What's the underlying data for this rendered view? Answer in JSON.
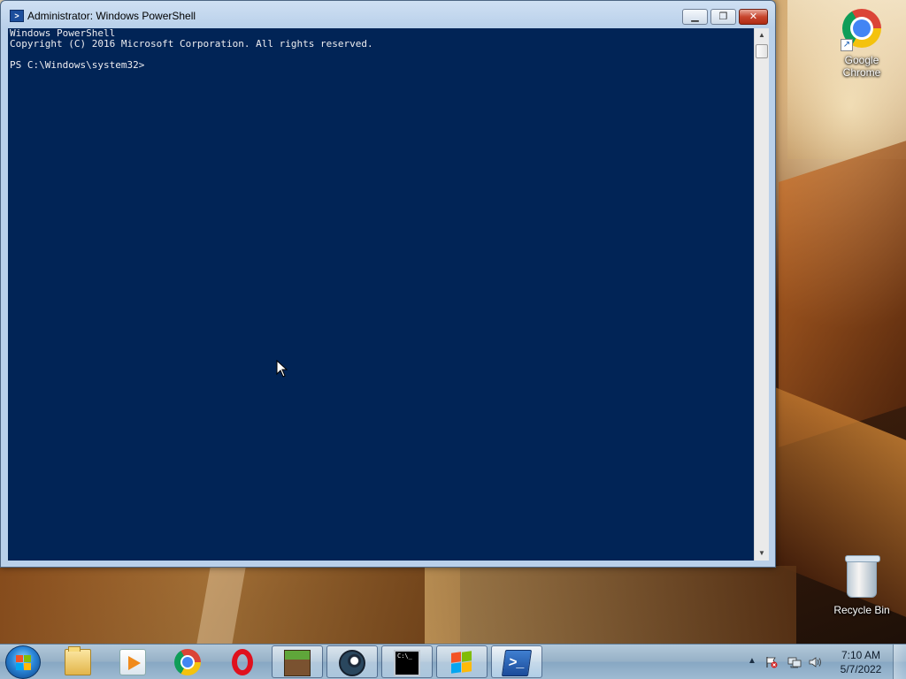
{
  "window": {
    "title": "Administrator: Windows PowerShell",
    "minimize_label": "▁",
    "maximize_label": "❐",
    "close_label": "✕"
  },
  "console": {
    "lines": [
      "Windows PowerShell",
      "Copyright (C) 2016 Microsoft Corporation. All rights reserved.",
      "",
      "PS C:\\Windows\\system32>"
    ],
    "background": "#012456",
    "foreground": "#eeedf0"
  },
  "desktop": {
    "icons": [
      {
        "label": "Google\nChrome",
        "icon": "chrome-icon"
      },
      {
        "label": "Recycle Bin",
        "icon": "recycle-bin-icon"
      }
    ]
  },
  "taskbar": {
    "items": [
      {
        "name": "windows-explorer",
        "icon": "folder-icon"
      },
      {
        "name": "windows-media-player",
        "icon": "media-player-icon"
      },
      {
        "name": "google-chrome",
        "icon": "chrome-icon"
      },
      {
        "name": "opera",
        "icon": "opera-icon"
      },
      {
        "name": "minecraft",
        "icon": "minecraft-icon"
      },
      {
        "name": "steam",
        "icon": "steam-icon"
      },
      {
        "name": "command-prompt",
        "icon": "cmd-icon"
      },
      {
        "name": "windows-update",
        "icon": "windows-logo-icon"
      },
      {
        "name": "windows-powershell",
        "icon": "powershell-icon",
        "active": true
      }
    ],
    "cmd_icon_text": "C:\\_",
    "ps_icon_text": ">_",
    "clock": {
      "time": "7:10 AM",
      "date": "5/7/2022"
    },
    "tray_expand_label": "▲"
  }
}
